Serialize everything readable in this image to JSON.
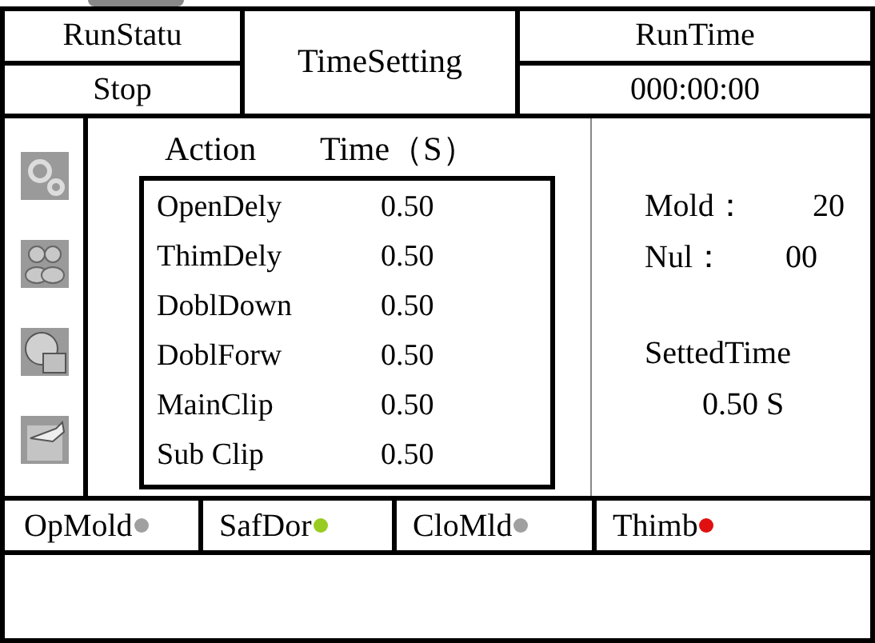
{
  "header": {
    "run_status_label": "RunStatu",
    "run_status": "Stop",
    "title": "TimeSetting",
    "run_time_label": "RunTime",
    "run_time": "000:00:00"
  },
  "table": {
    "columns": [
      "Action",
      "Time（S）"
    ],
    "rows": [
      {
        "action": "OpenDely",
        "time": "0.50"
      },
      {
        "action": "ThimDely",
        "time": "0.50"
      },
      {
        "action": "DoblDown",
        "time": "0.50"
      },
      {
        "action": "DoblForw",
        "time": "0.50"
      },
      {
        "action": "MainClip",
        "time": "0.50"
      },
      {
        "action": "Sub Clip",
        "time": "0.50"
      }
    ]
  },
  "info": {
    "mold_label": "Mold：",
    "mold": "20",
    "nul_label": "Nul：",
    "nul": "00",
    "setted_time_label": "SettedTime",
    "setted_time": "0.50 S"
  },
  "indicators": [
    {
      "label": "OpMold",
      "color": "#a0a0a0"
    },
    {
      "label": "SafDor",
      "color": "#99cc22"
    },
    {
      "label": "CloMld",
      "color": "#a0a0a0"
    },
    {
      "label": "Thimb",
      "color": "#e01010"
    }
  ]
}
